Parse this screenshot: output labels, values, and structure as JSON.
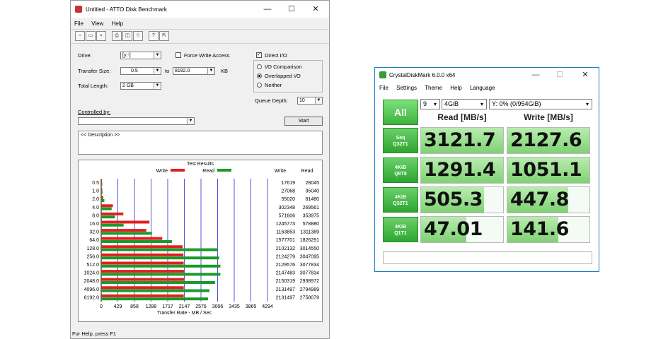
{
  "atto": {
    "title": "Untitled - ATTO Disk Benchmark",
    "controls": {
      "minimize": "—",
      "maximize": "☐",
      "close": "✕"
    },
    "menu": [
      "File",
      "View",
      "Help"
    ],
    "toolbar_icons": [
      "new-icon",
      "open-icon",
      "save-icon",
      "print-icon",
      "print-preview-icon",
      "split-icon",
      "help-icon",
      "context-help-icon"
    ],
    "drive_label": "Drive:",
    "drive_value": "[y:-]",
    "force_write_access": "Force Write Access",
    "direct_io": "Direct I/O",
    "transfer_size_label": "Transfer Size:",
    "transfer_from": "0.5",
    "transfer_to_label": "to",
    "transfer_to": "8192.0",
    "transfer_unit": "KB",
    "total_length_label": "Total Length:",
    "total_length": "2 GB",
    "radio_io_comparison": "I/O Comparison",
    "radio_overlapped": "Overlapped I/O",
    "radio_neither": "Neither",
    "queue_depth_label": "Queue Depth:",
    "queue_depth": "10",
    "controlled_by_label": "Controlled by:",
    "start_button": "Start",
    "description": "<< Description >>",
    "results_title": "Test Results",
    "legend_write": "Write",
    "legend_read": "Read",
    "col_write": "Write",
    "col_read": "Read",
    "x_axis_label": "Transfer Rate - MB / Sec",
    "x_ticks": [
      "0",
      "429",
      "858",
      "1288",
      "1717",
      "2147",
      "2576",
      "3006",
      "3435",
      "3865",
      "4294"
    ],
    "status": "For Help, press F1",
    "colors": {
      "write": "#e02020",
      "read": "#1a9a2a",
      "grid": "#2a2ad0"
    }
  },
  "chart_data": {
    "type": "bar",
    "title": "Test Results",
    "xlabel": "Transfer Rate - MB / Sec",
    "ylabel": "",
    "xlim": [
      0,
      4294
    ],
    "categories": [
      "0.5",
      "1.0",
      "2.0",
      "4.0",
      "8.0",
      "16.0",
      "32.0",
      "64.0",
      "128.0",
      "256.0",
      "512.0",
      "1024.0",
      "2048.0",
      "4096.0",
      "8192.0"
    ],
    "series": [
      {
        "name": "Write",
        "values": [
          17619,
          27068,
          55020,
          302348,
          571606,
          1245773,
          1163853,
          1577701,
          2102132,
          2124279,
          2129576,
          2147483,
          2150319,
          2131497,
          2131497
        ]
      },
      {
        "name": "Read",
        "values": [
          28045,
          35040,
          81480,
          269561,
          353975,
          578880,
          1311389,
          1826291,
          3014550,
          3047095,
          3077834,
          3077834,
          2938972,
          2794989,
          2758079
        ]
      }
    ]
  },
  "cdm": {
    "title": "CrystalDiskMark 6.0.0 x64",
    "controls": {
      "minimize": "—",
      "maximize": "☐",
      "close": "✕"
    },
    "menu": [
      "File",
      "Settings",
      "Theme",
      "Help",
      "Language"
    ],
    "all_button": "All",
    "count": "9",
    "size": "4GiB",
    "drive": "Y: 0% (0/954GiB)",
    "read_header": "Read [MB/s]",
    "write_header": "Write [MB/s]",
    "rows": [
      {
        "l1": "Seq",
        "l2": "Q32T1",
        "read": "3121.7",
        "write": "2127.6",
        "read_frac": 1.0,
        "write_frac": 1.0
      },
      {
        "l1": "4KiB",
        "l2": "Q8T8",
        "read": "1291.4",
        "write": "1051.1",
        "read_frac": 1.0,
        "write_frac": 1.0
      },
      {
        "l1": "4KiB",
        "l2": "Q32T1",
        "read": "505.3",
        "write": "447.8",
        "read_frac": 0.77,
        "write_frac": 0.74
      },
      {
        "l1": "4KiB",
        "l2": "Q1T1",
        "read": "47.01",
        "write": "141.6",
        "read_frac": 0.55,
        "write_frac": 0.62
      }
    ]
  }
}
